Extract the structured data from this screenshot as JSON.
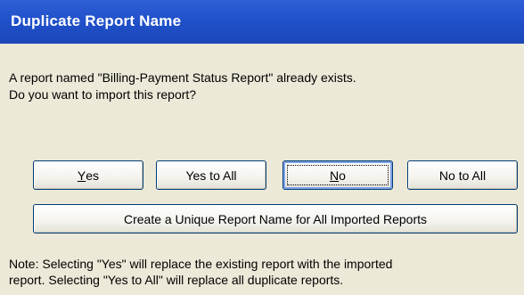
{
  "window": {
    "title": "Duplicate Report Name"
  },
  "message": {
    "line1": "A report named \"Billing-Payment Status Report\" already exists.",
    "line2": "Do you want to import this report?"
  },
  "buttons": {
    "yes": {
      "mnemonic": "Y",
      "rest": "es"
    },
    "yes_to_all": {
      "label": "Yes to All"
    },
    "no": {
      "mnemonic": "N",
      "rest": "o"
    },
    "no_to_all": {
      "label": "No to All"
    },
    "unique": {
      "label": "Create a Unique Report Name for All Imported Reports"
    }
  },
  "note": {
    "line1": "Note: Selecting \"Yes\" will replace the existing report with the imported",
    "line2": "report.  Selecting \"Yes to All\" will replace all duplicate reports."
  },
  "colors": {
    "titlebar": "#1f4fc8",
    "dialog_background": "#ece9d8",
    "button_border": "#003c74"
  }
}
